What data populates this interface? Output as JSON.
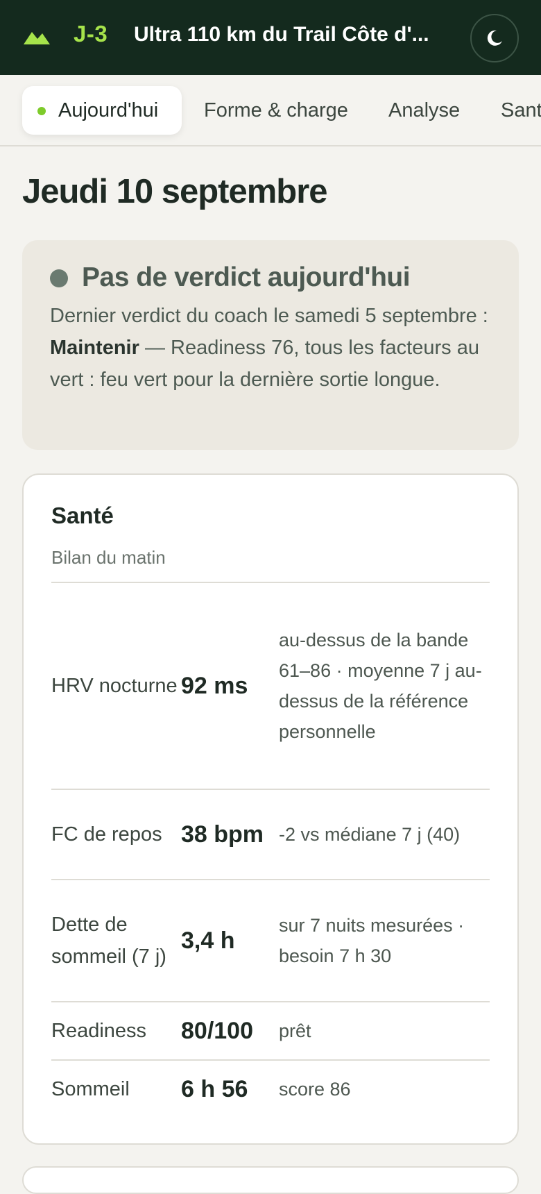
{
  "header": {
    "logo_icon": "mountain-icon",
    "countdown": "J-3",
    "title": "Ultra 110 km du Trail Côte d'...",
    "theme_icon": "moon-icon",
    "accent": "#a6e34b",
    "background": "#142a1e"
  },
  "tabs": [
    {
      "label": "Aujourd'hui",
      "active": true
    },
    {
      "label": "Forme & charge",
      "active": false
    },
    {
      "label": "Analyse",
      "active": false
    },
    {
      "label": "Sant",
      "active": false
    }
  ],
  "page": {
    "date_heading": "Jeudi 10 septembre"
  },
  "verdict": {
    "title": "Pas de verdict aujourd'hui",
    "body_prefix": "Dernier verdict du coach le samedi 5 septembre : ",
    "body_bold": "Maintenir",
    "body_suffix": " — Readiness 76, tous les facteurs au vert : feu vert pour la dernière sortie longue."
  },
  "health": {
    "title": "Santé",
    "subtitle": "Bilan du matin",
    "metrics": [
      {
        "label": "HRV nocturne",
        "value": "92 ms",
        "note": "au-dessus de la bande 61–86 · moyenne 7 j au-dessus de la référence personnelle"
      },
      {
        "label": "FC de repos",
        "value": "38 bpm",
        "note": "-2 vs médiane 7 j (40)"
      },
      {
        "label": "Dette de sommeil (7 j)",
        "value": "3,4 h",
        "note": "sur 7 nuits mesurées · besoin 7 h 30"
      },
      {
        "label": "Readiness",
        "value": "80/100",
        "note": "prêt"
      },
      {
        "label": "Sommeil",
        "value": "6 h 56",
        "note": "score 86"
      }
    ]
  }
}
